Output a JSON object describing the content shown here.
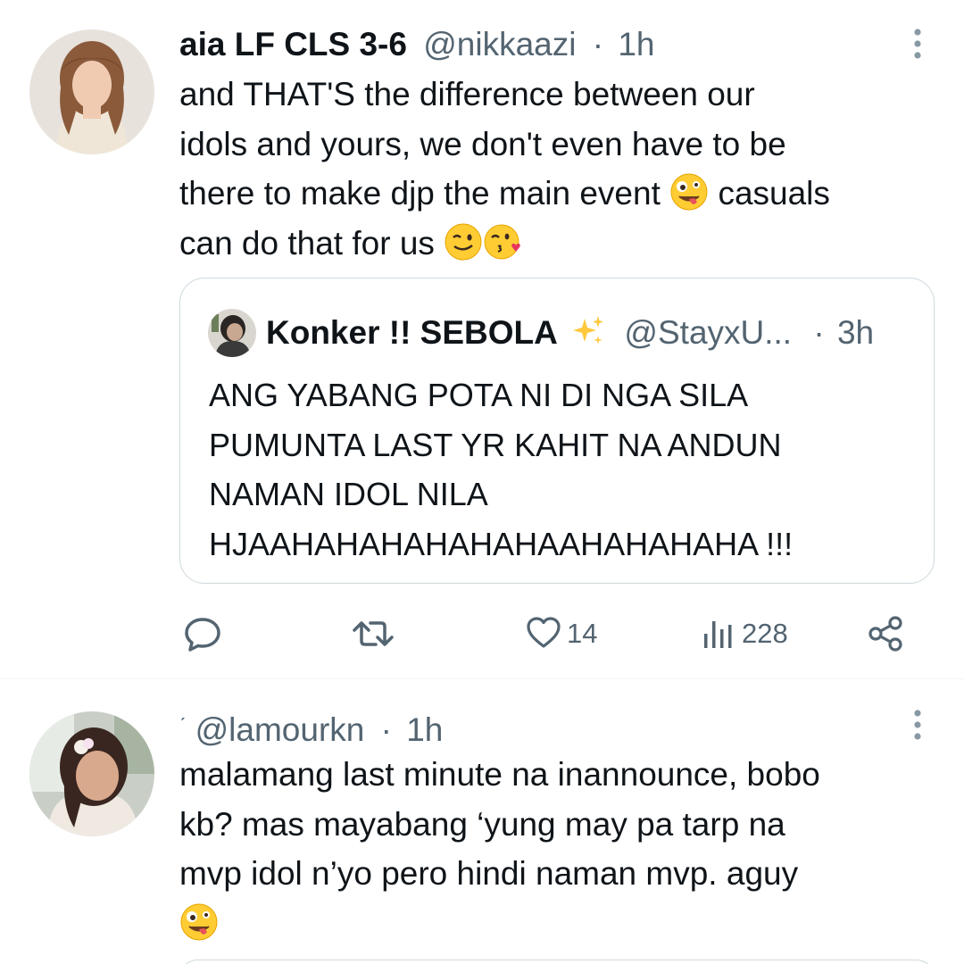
{
  "tweets": [
    {
      "display_name": "aia LF CLS 3-6",
      "handle": "@nikkaazi",
      "separator": "·",
      "time": "1h",
      "text_lines": [
        "and THAT'S the difference between our",
        "idols and yours, we don't even have to be",
        "there to make djp the main event",
        "casuals",
        "can do that for us"
      ],
      "quote": {
        "display_name": "Konker !! SEBOLA",
        "handle": "@StayxU...",
        "separator": "·",
        "time": "3h",
        "text_lines": [
          "ANG YABANG POTA NI DI NGA SILA",
          "PUMUNTA LAST YR KAHIT NA ANDUN",
          "NAMAN IDOL NILA",
          "HJAAHAHAHAHAHAHAAHAHAHAHA !!!"
        ]
      },
      "actions": {
        "like_count": "14",
        "views_count": "228"
      }
    },
    {
      "display_name": "ˊ",
      "handle": "@lamourkn",
      "separator": "·",
      "time": "1h",
      "text_lines": [
        "malamang last minute na inannounce, bobo",
        "kb? mas mayabang ‘yung may pa tarp na",
        "mvp idol n’yo pero hindi naman mvp. aguy"
      ]
    }
  ],
  "icons": {
    "reply": "reply-icon",
    "retweet": "retweet-icon",
    "like": "heart-icon",
    "views": "views-icon",
    "share": "share-icon",
    "more": "more-vertical-icon"
  },
  "colors": {
    "text": "#0f1419",
    "secondary": "#536471",
    "border": "#cfd9de",
    "divider": "#eff3f4"
  }
}
